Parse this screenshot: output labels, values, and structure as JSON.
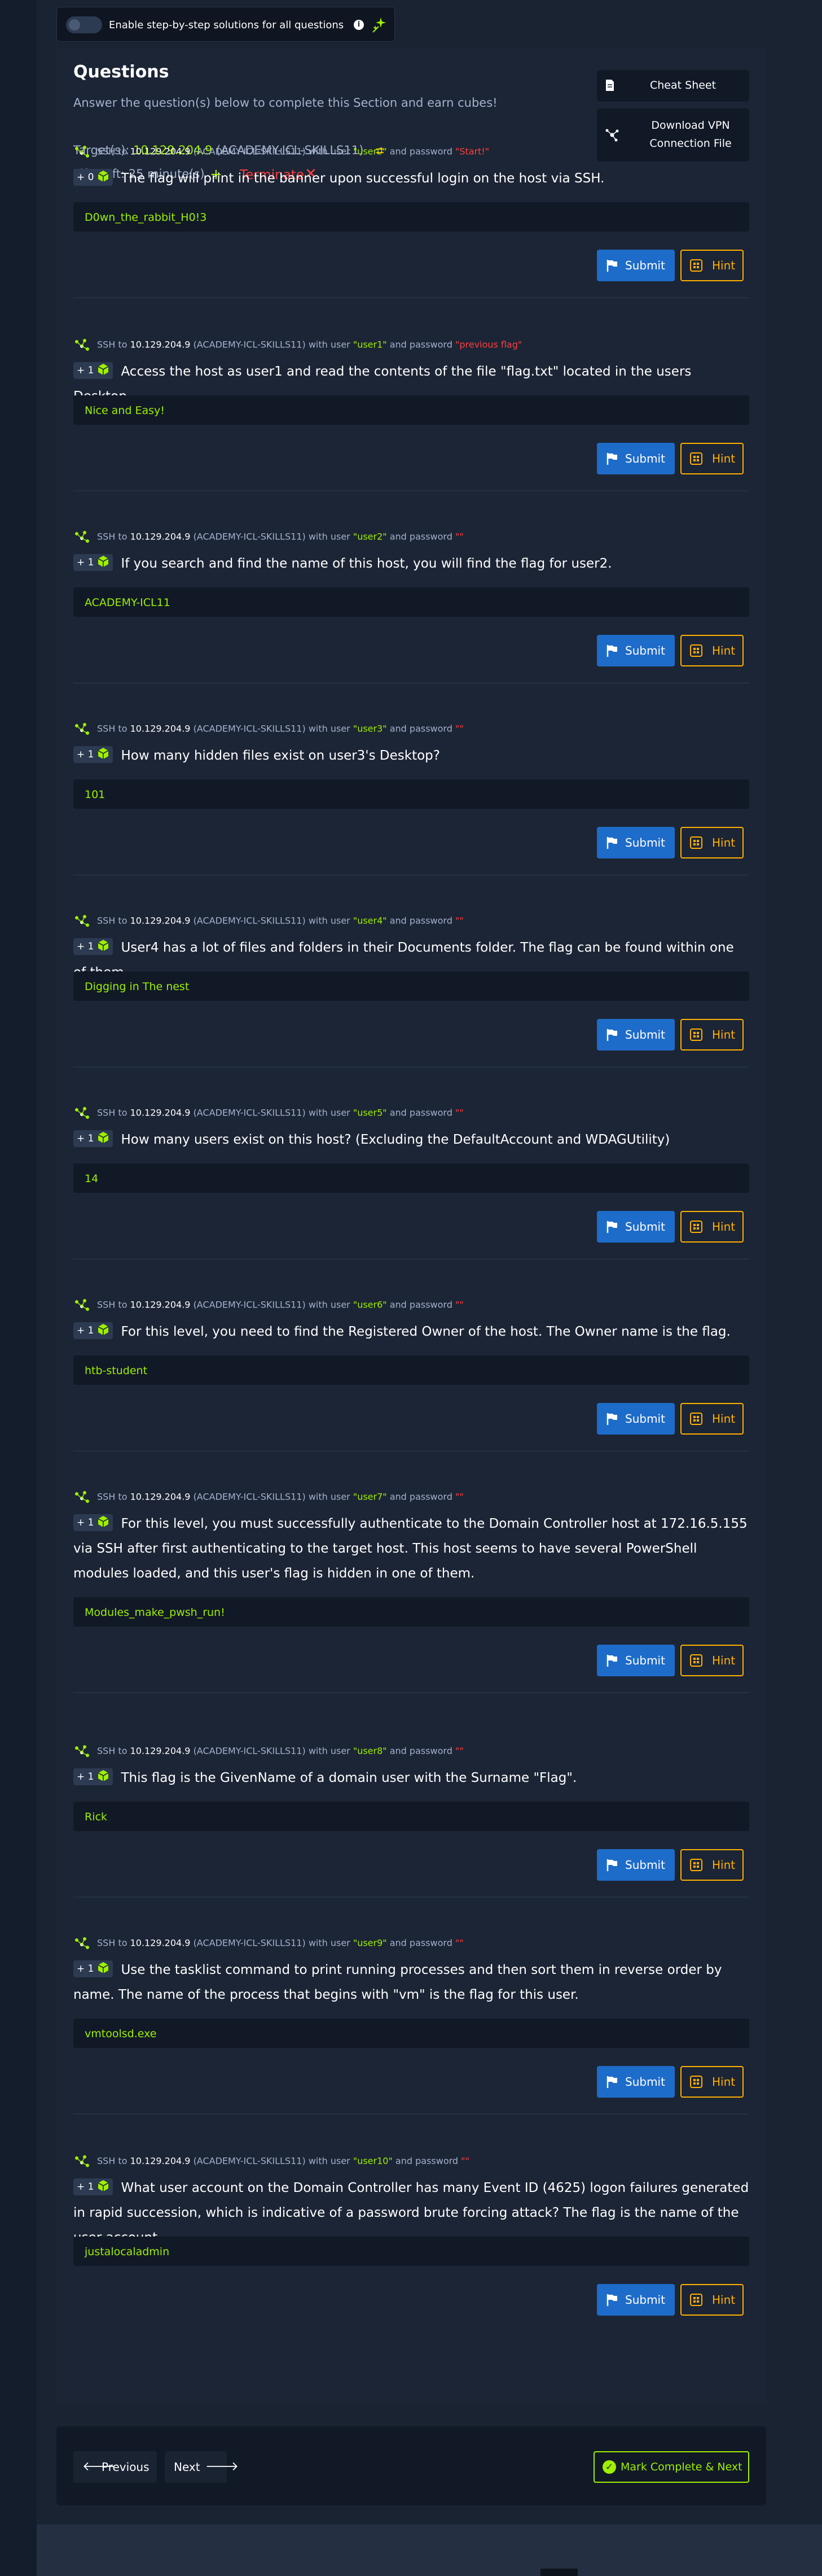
{
  "toggle": {
    "label": "Enable step-by-step solutions for all questions",
    "info": "i"
  },
  "section": {
    "title": "Questions",
    "subtitle": "Answer the question(s) below to complete this Section and earn cubes!",
    "target_prefix": "Target(s):",
    "target_ip": "10.129.204.9",
    "target_name": "(ACADEMY-ICL-SKILLS11)",
    "life_left": "Life Left: 25 minute(s)",
    "plus": "+",
    "terminate": "Terminate",
    "terminate_x": "✕"
  },
  "sidebar": {
    "cheat_sheet": "Cheat Sheet",
    "vpn": "Download VPN Connection File"
  },
  "ssh": {
    "prefix": "SSH to",
    "host_name": "(ACADEMY-ICL-SKILLS11)",
    "with_user": "with user",
    "and_password": "and password",
    "cube_label": ""
  },
  "buttons": {
    "submit": "Submit",
    "hint": "Hint"
  },
  "questions": [
    {
      "ip": "10.129.204.9",
      "user": "\"user0\"",
      "password": "\"Start!\"",
      "badge": "+ 0",
      "text": "The flag will print in the banner upon successful login on the host via SSH.",
      "answer": "D0wn_the_rabbit_H0!3"
    },
    {
      "ip": "10.129.204.9",
      "user": "\"user1\"",
      "password": "\"previous flag\"",
      "badge": "+ 1",
      "text": "Access the host as user1 and read the contents of the file \"flag.txt\" located in the users Desktop.",
      "answer": "Nice and Easy!"
    },
    {
      "ip": "10.129.204.9",
      "user": "\"user2\"",
      "password": "\"\"",
      "badge": "+ 1",
      "text": "If you search and find the name of this host, you will find the flag for user2.",
      "answer": "ACADEMY-ICL11"
    },
    {
      "ip": "10.129.204.9",
      "user": "\"user3\"",
      "password": "\"\"",
      "badge": "+ 1",
      "text": "How many hidden files exist on user3's Desktop?",
      "answer": "101"
    },
    {
      "ip": "10.129.204.9",
      "user": "\"user4\"",
      "password": "\"\"",
      "badge": "+ 1",
      "text": "User4 has a lot of files and folders in their Documents folder. The flag can be found within one of them.",
      "answer": "Digging in The nest"
    },
    {
      "ip": "10.129.204.9",
      "user": "\"user5\"",
      "password": "\"\"",
      "badge": "+ 1",
      "text": "How many users exist on this host? (Excluding the DefaultAccount and WDAGUtility)",
      "answer": "14"
    },
    {
      "ip": "10.129.204.9",
      "user": "\"user6\"",
      "password": "\"\"",
      "badge": "+ 1",
      "text": "For this level, you need to find the Registered Owner of the host. The Owner name is the flag.",
      "answer": "htb-student"
    },
    {
      "ip": "10.129.204.9",
      "user": "\"user7\"",
      "password": "\"\"",
      "badge": "+ 1",
      "text": "For this level, you must successfully authenticate to the Domain Controller host at 172.16.5.155 via SSH after first authenticating to the target host. This host seems to have several PowerShell modules loaded, and this user's flag is hidden in one of them.",
      "answer": "Modules_make_pwsh_run!"
    },
    {
      "ip": "10.129.204.9",
      "user": "\"user8\"",
      "password": "\"\"",
      "badge": "+ 1",
      "text": "This flag is the GivenName of a domain user with the Surname \"Flag\".",
      "answer": "Rick"
    },
    {
      "ip": "10.129.204.9",
      "user": "\"user9\"",
      "password": "\"\"",
      "badge": "+ 1",
      "text": "Use the tasklist command to print running processes and then sort them in reverse order by name. The name of the process that begins with \"vm\" is the flag for this user.",
      "answer": "vmtoolsd.exe"
    },
    {
      "ip": "10.129.204.9",
      "user": "\"user10\"",
      "password": "\"\"",
      "badge": "+ 1",
      "text": "What user account on the Domain Controller has many Event ID (4625) logon failures generated in rapid succession, which is indicative of a password brute forcing attack? The flag is the name of the user account.",
      "answer": "justalocaladmin"
    }
  ],
  "nav": {
    "previous": "Previous",
    "next": "Next",
    "complete": "Mark Complete & Next",
    "prev_arrow": "🡐",
    "next_arrow": "🡒",
    "check": "✓"
  },
  "colors": {
    "accent_green": "#9fef00",
    "danger_red": "#ff3e3e",
    "submit_blue": "#1e6cc9",
    "hint_orange": "#ffaf00"
  }
}
